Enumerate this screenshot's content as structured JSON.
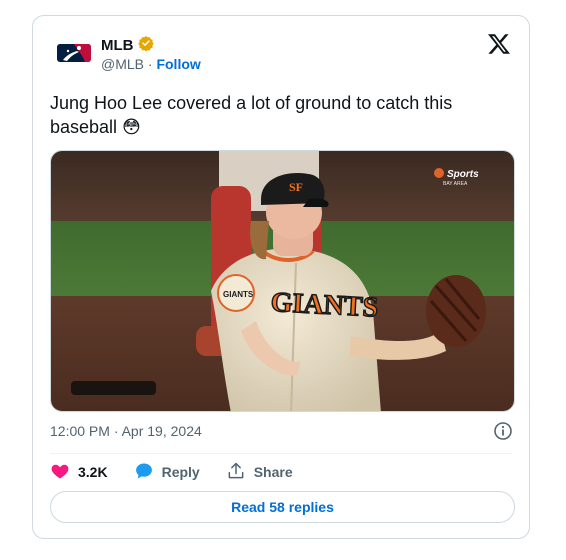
{
  "account": {
    "name": "MLB",
    "handle": "@MLB",
    "separator": "·",
    "follow_label": "Follow",
    "verified_color": "#e8a700"
  },
  "tweet": {
    "text": "Jung Hoo Lee covered a lot of ground to catch this baseball 😳",
    "timestamp": "12:00 PM · Apr 19, 2024"
  },
  "media": {
    "jersey_text": "GIANTS",
    "sleeve_patch_text": "GIANTS",
    "broadcast_logo_text": "Sports",
    "broadcast_logo_subtext": "BAY AREA"
  },
  "actions": {
    "likes_count": "3.2K",
    "reply_label": "Reply",
    "share_label": "Share"
  },
  "read_replies_label": "Read 58 replies",
  "colors": {
    "like_color": "#f91880",
    "reply_icon_color": "#1d9bf0",
    "link_color": "#006fd6",
    "mlb_blue": "#041e42",
    "mlb_red": "#bf0d3e"
  }
}
